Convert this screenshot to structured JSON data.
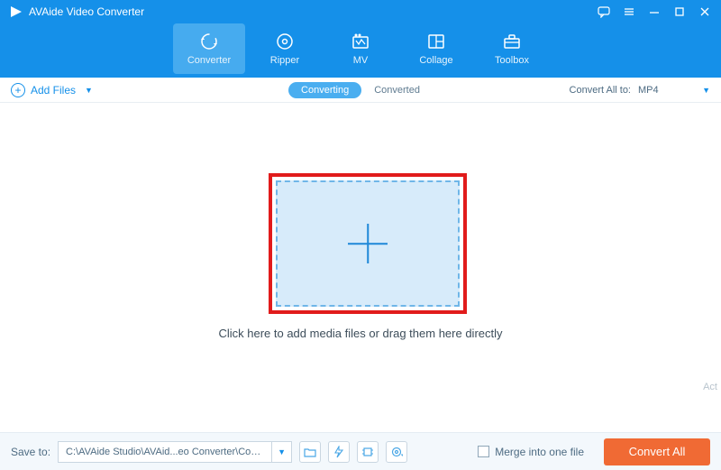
{
  "app": {
    "title": "AVAide Video Converter"
  },
  "nav": {
    "items": [
      {
        "label": "Converter"
      },
      {
        "label": "Ripper"
      },
      {
        "label": "MV"
      },
      {
        "label": "Collage"
      },
      {
        "label": "Toolbox"
      }
    ]
  },
  "toolbar": {
    "add_files_label": "Add Files",
    "converting_label": "Converting",
    "converted_label": "Converted",
    "convert_all_to_label": "Convert All to:",
    "format_value": "MP4"
  },
  "dropzone": {
    "hint": "Click here to add media files or drag them here directly"
  },
  "footer": {
    "save_to_label": "Save to:",
    "save_path": "C:\\AVAide Studio\\AVAid...eo Converter\\Converted",
    "merge_label": "Merge into one file",
    "convert_all_label": "Convert All"
  },
  "misc": {
    "watermark": "Act"
  }
}
